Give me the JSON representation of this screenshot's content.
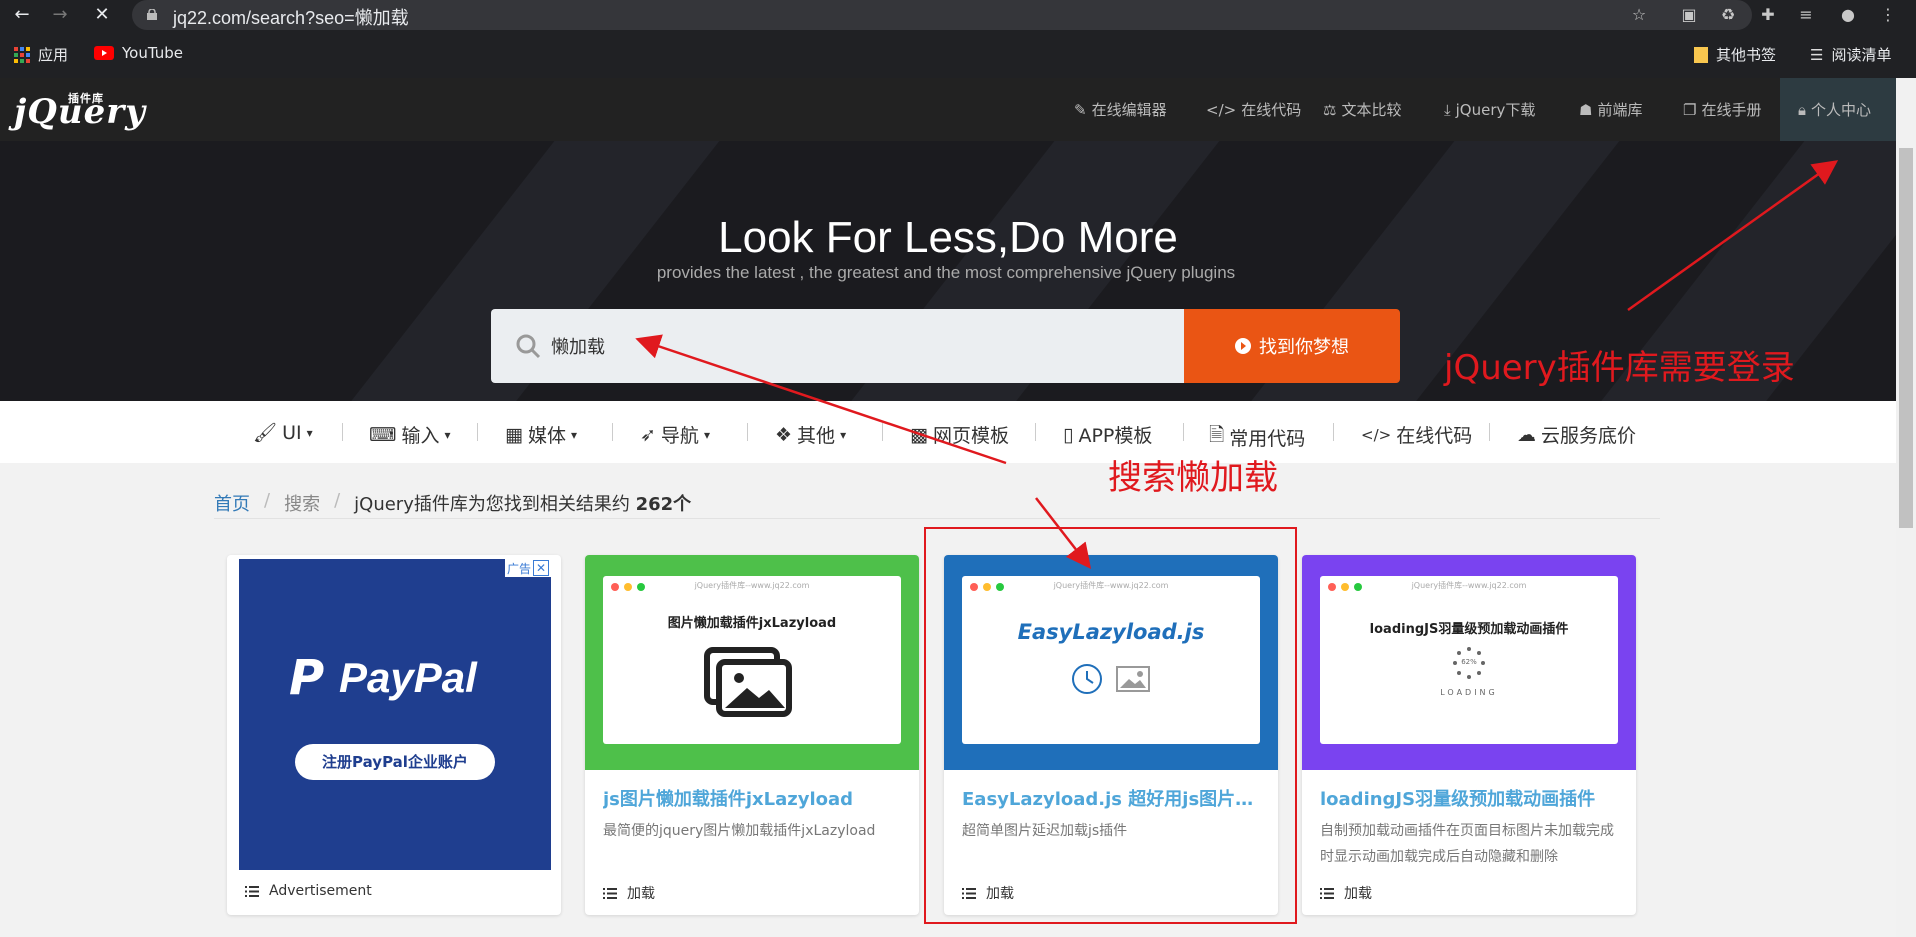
{
  "browser": {
    "url": "jq22.com/search?seo=懒加载",
    "bookmarks": {
      "apps": "应用",
      "youtube": "YouTube",
      "other": "其他书签",
      "reading": "阅读清单"
    }
  },
  "site": {
    "top_nav": [
      "在线编辑器",
      "在线代码",
      "文本比较",
      "jQuery下载",
      "前端库",
      "在线手册",
      "个人中心"
    ],
    "hero_title": "Look For Less,Do More",
    "hero_subtitle": "provides the latest , the greatest and the most comprehensive jQuery plugins",
    "search_value": "懒加载",
    "search_button": "找到你梦想",
    "categories": [
      "UI",
      "输入",
      "媒体",
      "导航",
      "其他",
      "网页模板",
      "APP模板",
      "常用代码",
      "在线代码",
      "云服务底价"
    ],
    "breadcrumb": {
      "home": "首页",
      "search": "搜索",
      "result_prefix": "jQuery插件库为您找到相关结果约",
      "result_count": "262个"
    }
  },
  "ad": {
    "brand": "PayPal",
    "cta": "注册PayPal企业账户",
    "badge": "广告",
    "label": "Advertisement"
  },
  "cards": [
    {
      "title": "js图片懒加载插件jxLazyload",
      "desc": "最简便的jquery图片懒加载插件jxLazyload",
      "tag": "加载",
      "thumb_text": "图片懒加载插件jxLazyload",
      "thumb_color": "#4ec04a"
    },
    {
      "title": "EasyLazyload.js 超好用js图片延迟加载插件",
      "desc": "超简单图片延迟加载js插件",
      "tag": "加载",
      "thumb_text": "EasyLazyload.js",
      "thumb_color": "#1f6fba"
    },
    {
      "title": "loadingJS羽量级预加载动画插件",
      "desc": "自制预加载动画插件在页面目标图片未加载完成时显示动画加载完成后自动隐藏和删除",
      "tag": "加载",
      "thumb_text": "loadingJS羽量级预加载动画插件",
      "thumb_color": "#7a43f0",
      "loading_word": "LOADING",
      "percent": "62%"
    }
  ],
  "mock_url": "jQuery插件库--www.jq22.com",
  "annotations": {
    "login_note": "jQuery插件库需要登录",
    "search_note": "搜索懒加载"
  },
  "colors": {
    "accent_orange": "#ea5514",
    "annotation_red": "#e0191e",
    "link_blue": "#4fa6d9"
  }
}
